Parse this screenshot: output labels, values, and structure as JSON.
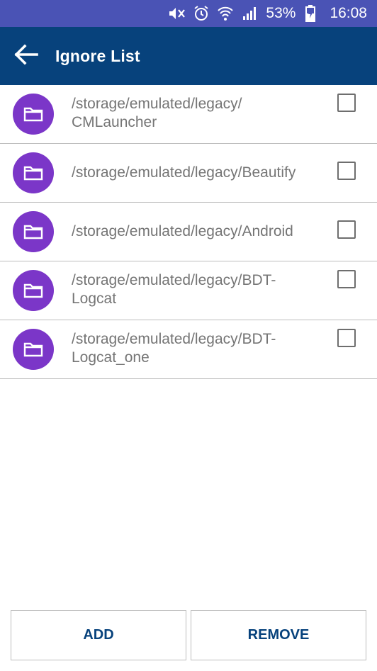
{
  "status_bar": {
    "battery_percent": "53%",
    "time": "16:08",
    "icons": [
      "mute-icon",
      "alarm-icon",
      "wifi-icon",
      "signal-icon",
      "battery-charging-icon"
    ]
  },
  "app_bar": {
    "title": "Ignore List",
    "back_icon": "arrow-back-icon"
  },
  "list": {
    "items": [
      {
        "path": "/storage/emulated/legacy/CMLauncher",
        "line1": "/storage/emulated/legacy/",
        "line2": "CMLauncher",
        "checked": false
      },
      {
        "path": "/storage/emulated/legacy/Beautify",
        "line1": "/storage/emulated/legacy/Beautify",
        "line2": "",
        "checked": false
      },
      {
        "path": "/storage/emulated/legacy/Android",
        "line1": "/storage/emulated/legacy/Android",
        "line2": "",
        "checked": false
      },
      {
        "path": "/storage/emulated/legacy/BDT-Logcat",
        "line1": "/storage/emulated/legacy/BDT-",
        "line2": "Logcat",
        "checked": false
      },
      {
        "path": "/storage/emulated/legacy/BDT-Logcat_one",
        "line1": "/storage/emulated/legacy/BDT-",
        "line2": "Logcat_one",
        "checked": false
      }
    ]
  },
  "buttons": {
    "add_label": "ADD",
    "remove_label": "REMOVE"
  },
  "colors": {
    "status_bar": "#4a53b5",
    "app_bar": "#07427c",
    "avatar": "#7b36c8",
    "button_text": "#07427c"
  }
}
